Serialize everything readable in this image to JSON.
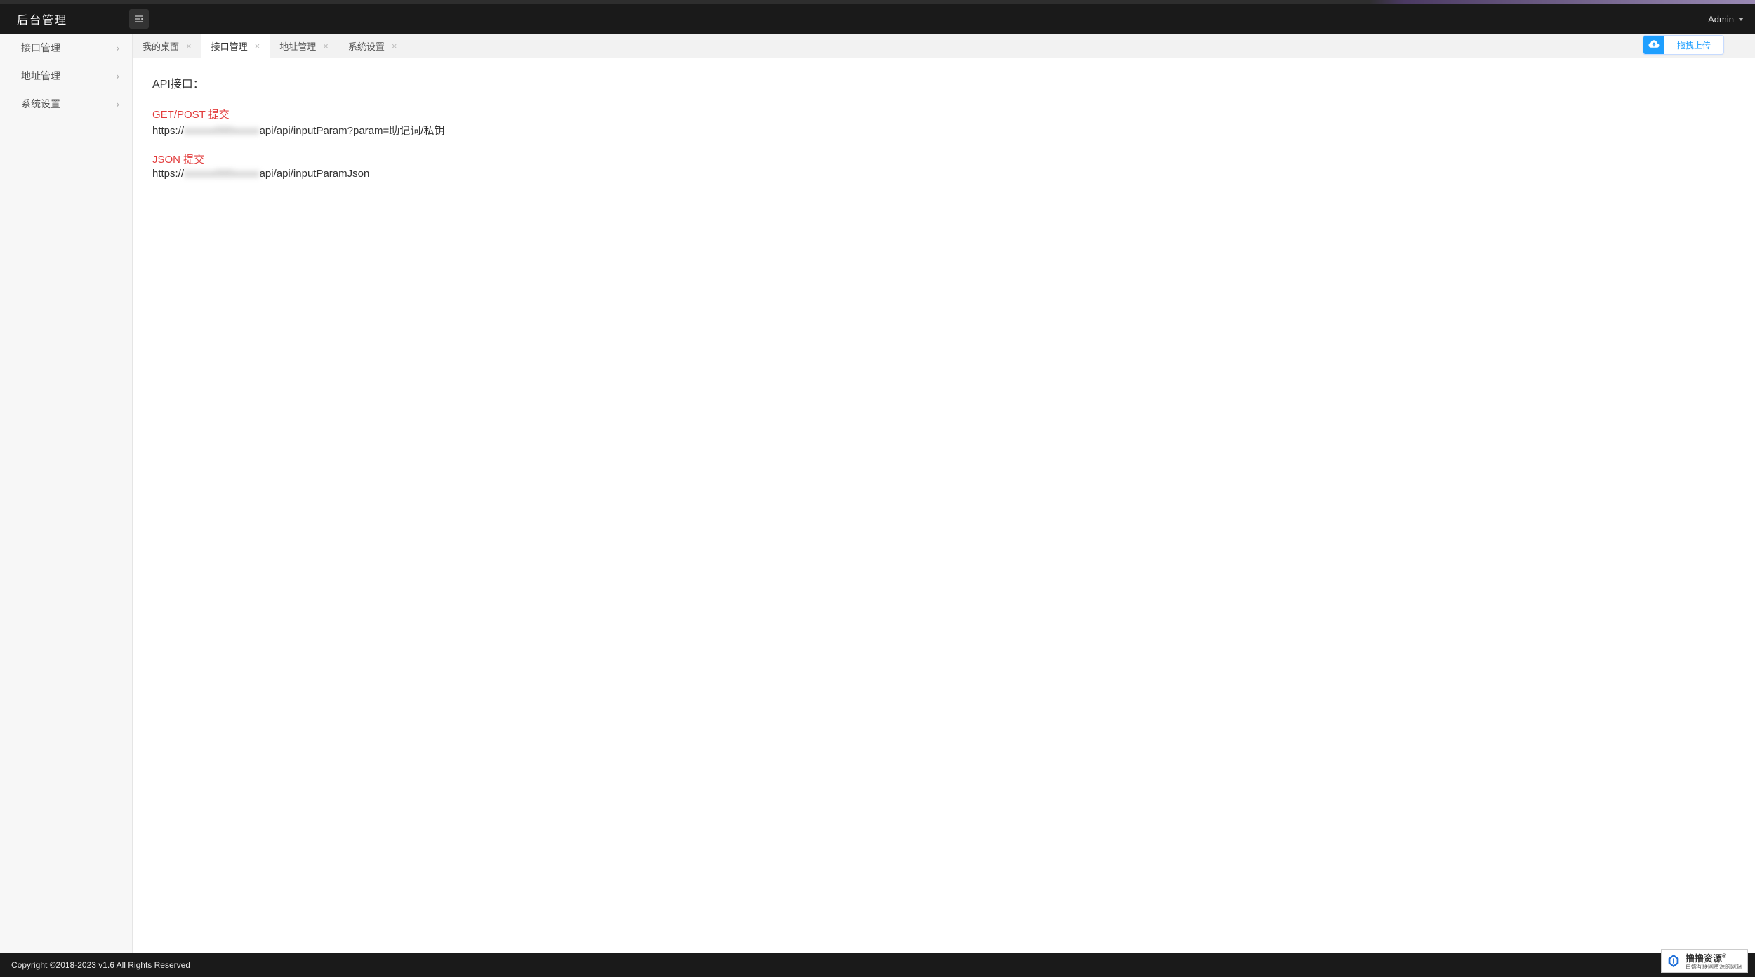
{
  "header": {
    "brand": "后台管理",
    "user": "Admin"
  },
  "upload": {
    "label": "拖拽上传"
  },
  "sidebar": {
    "items": [
      {
        "label": "接口管理"
      },
      {
        "label": "地址管理"
      },
      {
        "label": "系统设置"
      }
    ]
  },
  "tabs": [
    {
      "label": "我的桌面",
      "active": false
    },
    {
      "label": "接口管理",
      "active": true
    },
    {
      "label": "地址管理",
      "active": false
    },
    {
      "label": "系统设置",
      "active": false
    }
  ],
  "page": {
    "title": "API接口：",
    "sections": [
      {
        "heading": "GET/POST 提交",
        "url_prefix": "https://",
        "url_hidden": "xxxxxx000xxxxx",
        "url_suffix": "api/api/inputParam?param=助记词/私钥"
      },
      {
        "heading": "JSON 提交",
        "url_prefix": "https://",
        "url_hidden": "xxxxxx000xxxxx",
        "url_suffix": "api/api/inputParamJson"
      }
    ]
  },
  "footer": {
    "copyright": "Copyright ©2018-2023 v1.6 All Rights Reserved"
  },
  "watermark": {
    "name": "撸撸资源",
    "sub": "白嫖互联网资源的网站"
  }
}
